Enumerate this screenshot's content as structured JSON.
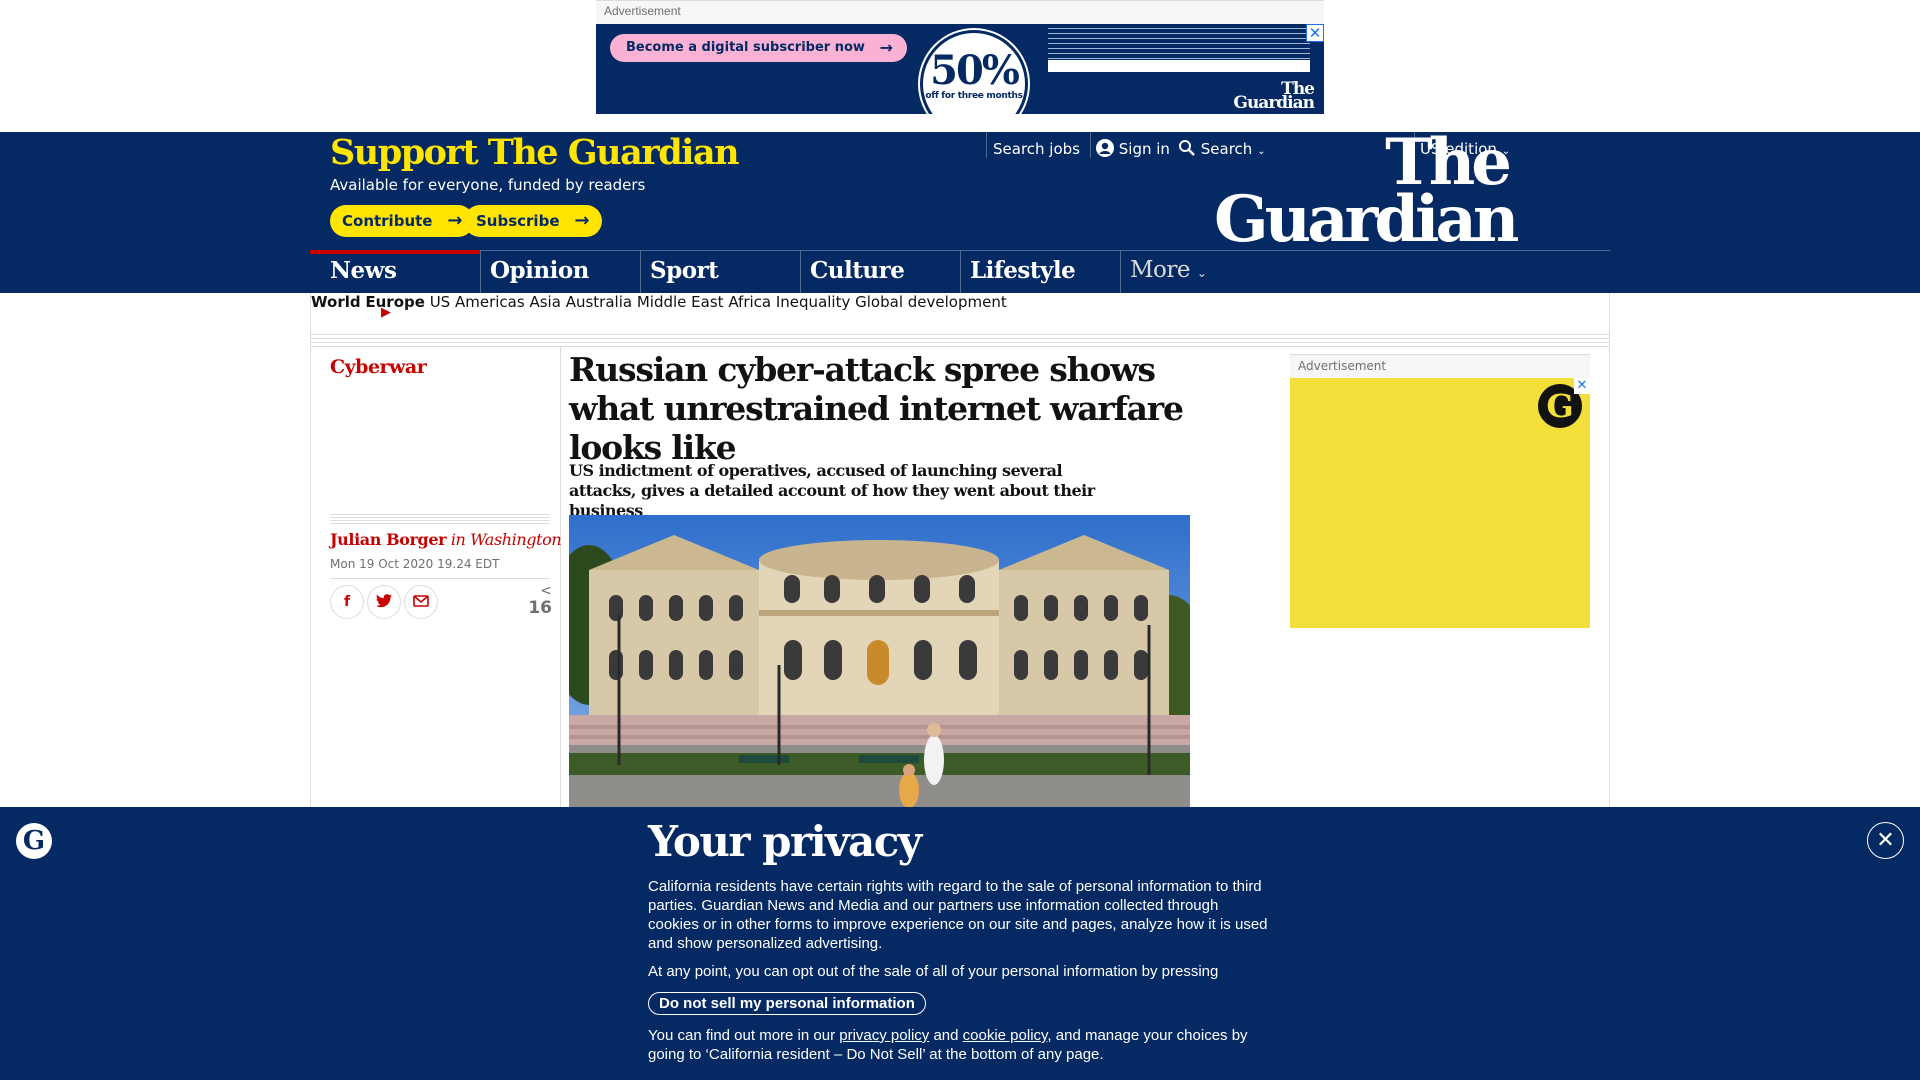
{
  "ad_top": {
    "label": "Advertisement",
    "cta": "Become a digital subscriber now",
    "percent": "50%",
    "percent_caption": "off for three months",
    "logo_line1": "The",
    "logo_line2": "Guardian",
    "close": "✕"
  },
  "header": {
    "support_title": "Support The Guardian",
    "support_subtitle": "Available for everyone, funded by readers",
    "contribute_label": "Contribute",
    "subscribe_label": "Subscribe",
    "search_jobs": "Search jobs",
    "sign_in": "Sign in",
    "search": "Search",
    "edition": "US edition",
    "logo_line1": "The",
    "logo_line2": "Guardian",
    "arrow": "→"
  },
  "pillars": [
    "News",
    "Opinion",
    "Sport",
    "Culture",
    "Lifestyle",
    "More"
  ],
  "subnav": {
    "parent": "World",
    "current": "Europe",
    "items": [
      "US",
      "Americas",
      "Asia",
      "Australia",
      "Middle East",
      "Africa",
      "Inequality",
      "Global development"
    ]
  },
  "article": {
    "series": "Cyberwar",
    "headline": "Russian cyber-attack spree shows what unrestrained internet warfare looks like",
    "standfirst": "US indictment of operatives, accused of launching several attacks, gives a detailed account of how they went about their business",
    "byline_name": "Julian Borger",
    "byline_location": "in Washington",
    "date": "Mon 19 Oct 2020 19.24 EDT",
    "share_count": "16"
  },
  "ad_right": {
    "label": "Advertisement",
    "logo": "G",
    "close": "✕"
  },
  "privacy": {
    "title": "Your privacy",
    "paragraph1": "California residents have certain rights with regard to the sale of personal information to third parties. Guardian News and Media and our partners use information collected through cookies or in other forms to improve experience on our site and pages, analyze how it is used and show personalized advertising.",
    "paragraph2": "At any point, you can opt out of the sale of all of your personal information by pressing",
    "button": "Do not sell my personal information",
    "p3_before": "You can find out more in our ",
    "privacy_policy": "privacy policy",
    "and": " and ",
    "cookie_policy": "cookie policy",
    "p3_after": ", and manage your choices by going to ‘California resident – Do Not Sell’ at the bottom of any page.",
    "close": "✕",
    "logo": "G"
  },
  "colors": {
    "brand_blue": "#052962",
    "brand_yellow": "#ffe500",
    "news_red": "#c70000"
  }
}
